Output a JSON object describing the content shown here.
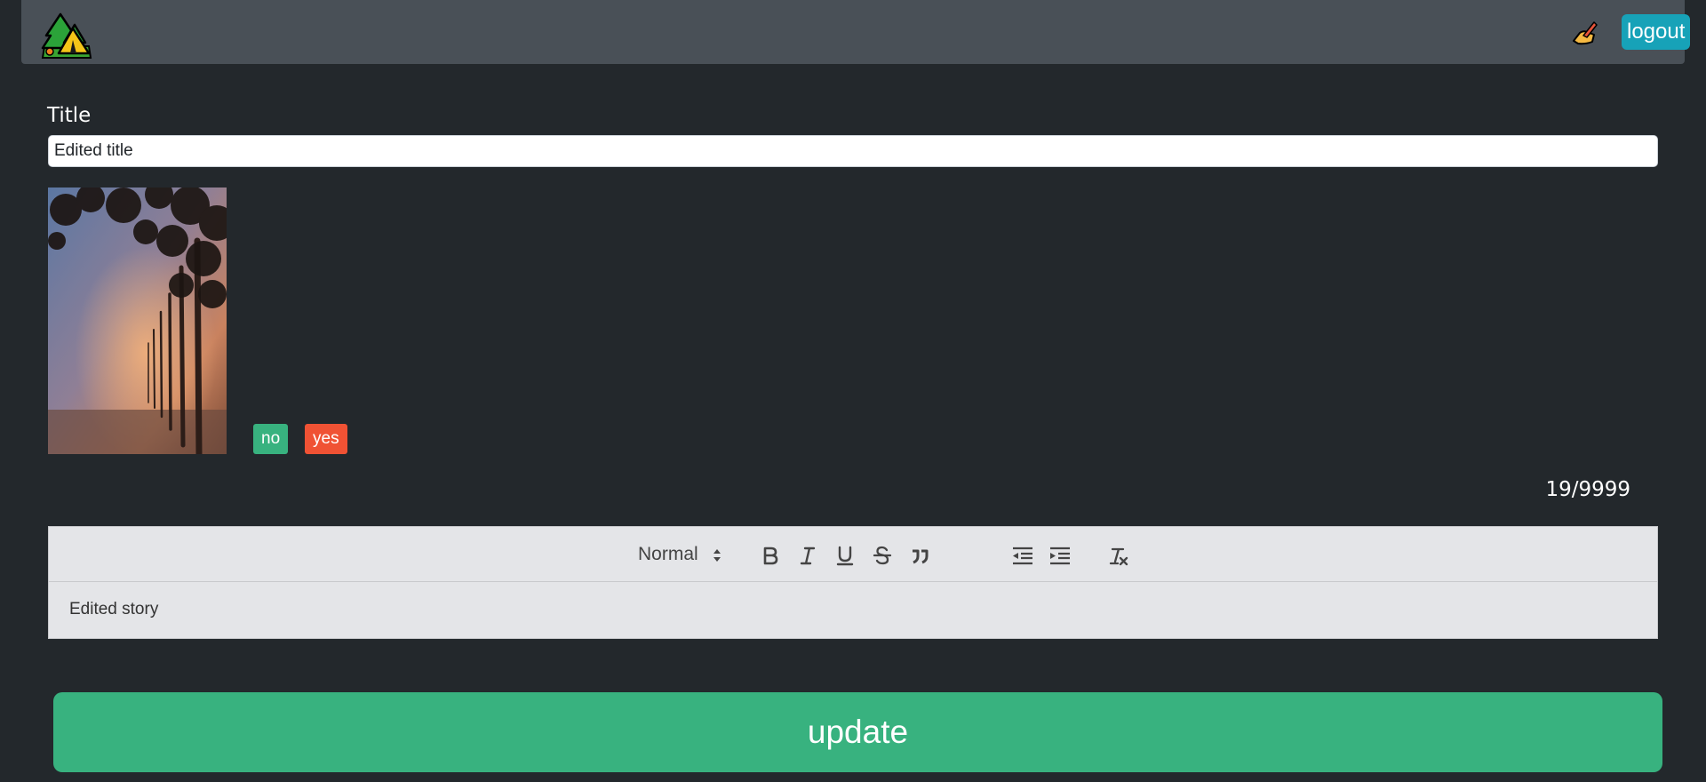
{
  "header": {
    "logo_icon": "camping-tent-logo-icon",
    "write_icon": "writing-hand-icon",
    "logout_label": "logout"
  },
  "form": {
    "title_label": "Title",
    "title_value": "Edited title",
    "image": {
      "description": "foggy tree-lined path at dusk",
      "buttons": {
        "no": "no",
        "yes": "yes"
      }
    },
    "counter": "19/9999",
    "editor": {
      "format_select": "Normal",
      "tools": [
        "bold",
        "italic",
        "underline",
        "strike",
        "blockquote",
        "outdent",
        "indent",
        "clean"
      ],
      "content": "Edited story"
    },
    "submit_label": "update"
  },
  "colors": {
    "page_bg": "#23282c",
    "navbar_bg": "#495057",
    "logout_bg": "#17a2b8",
    "no_bg": "#38b27f",
    "yes_bg": "#f05234",
    "update_bg": "#38b27f",
    "editor_bg": "#e4e5e8"
  }
}
